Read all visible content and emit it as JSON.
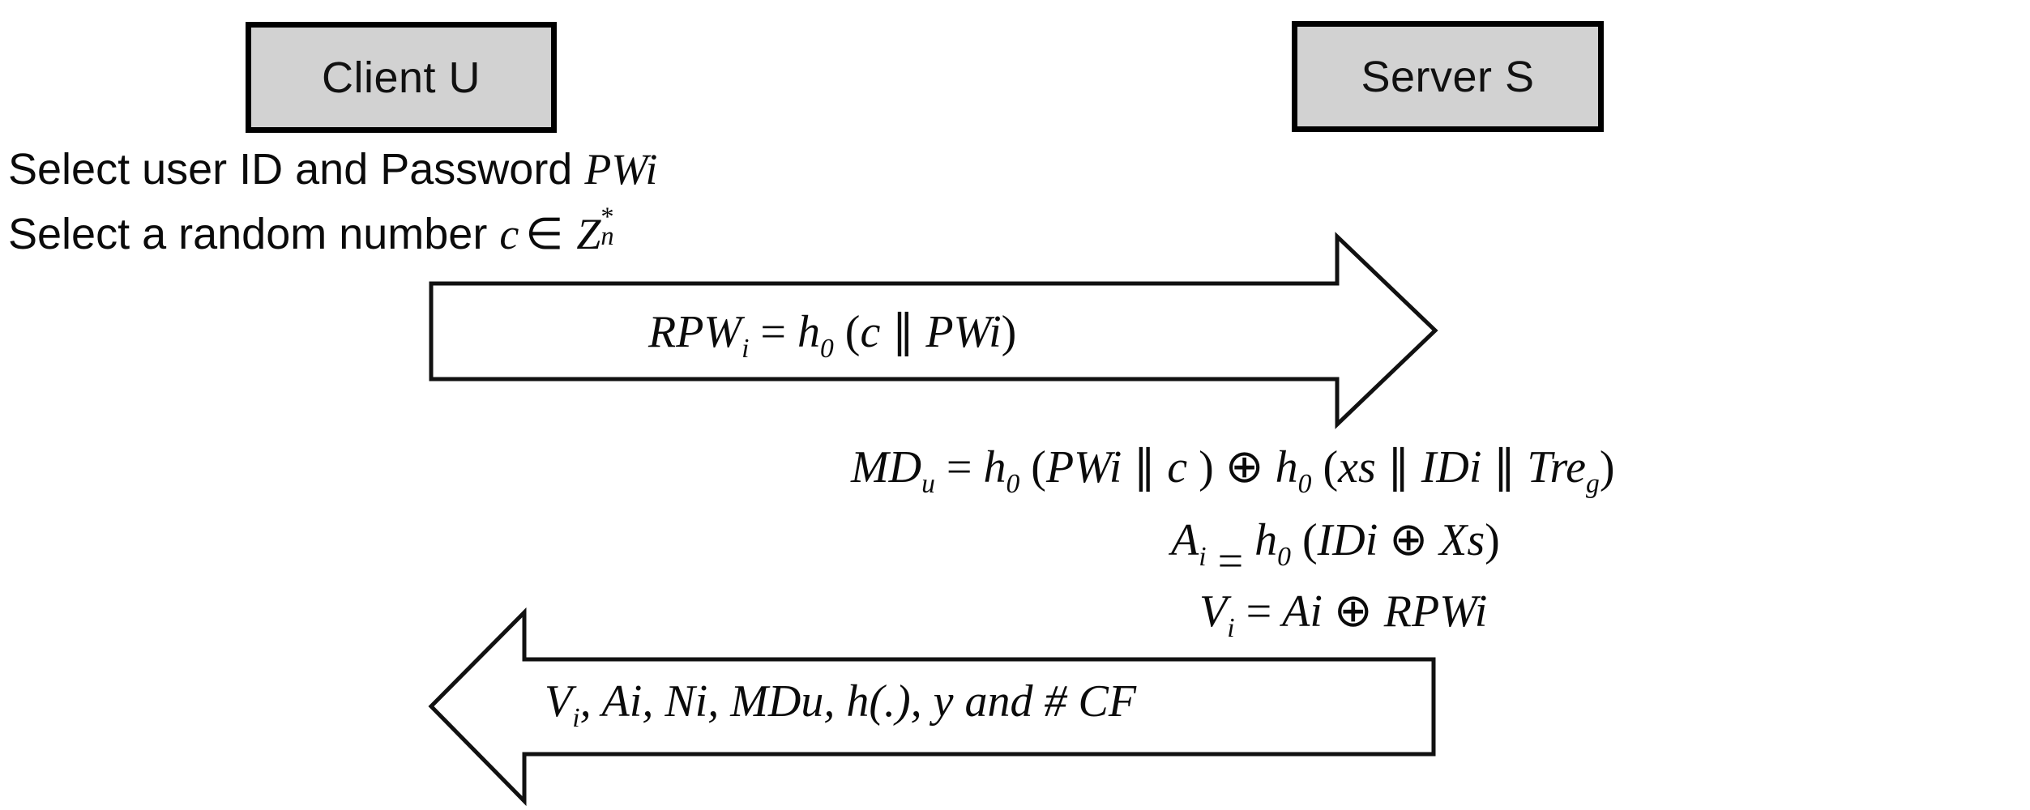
{
  "diagram": {
    "title": "Client-Server registration phase protocol",
    "background_color": "#ffffff",
    "box_fill_color": "#d2d2d2",
    "stroke_color": "#111111"
  },
  "entities": {
    "client": {
      "label": "Client U",
      "name": "client-entity"
    },
    "server": {
      "label": "Server S",
      "name": "server-entity"
    }
  },
  "client_steps": [
    {
      "id": "step-select-id-password",
      "prefix": "Select user ID and Password ",
      "symbol": "PWi"
    },
    {
      "id": "step-select-random",
      "prefix": "Select a random number ",
      "symbol_c": "c",
      "member_op": "∈",
      "set_base": "Z",
      "set_star": "*",
      "set_sub": "n"
    }
  ],
  "messages": [
    {
      "id": "msg-client-to-server",
      "direction": "right",
      "from": "Client U",
      "to": "Server S",
      "label_parts": {
        "lhs": "RPW",
        "lhs_sub": "i",
        "equals": "=",
        "hash": "h",
        "hash_sub": "0",
        "open": " (",
        "arg1": "c",
        "concat": "∥",
        "arg2": "PWi",
        "close": ")"
      },
      "label_plain": "RPWi = h0 (c ∥ PWi)"
    },
    {
      "id": "msg-server-to-client",
      "direction": "left",
      "from": "Server S",
      "to": "Client U",
      "label_parts": {
        "v": "V",
        "v_sub": "i",
        "rest": ", Ai, Ni, MDu, h(.), y and # CF"
      },
      "label_plain": "Vi, Ai, Ni, MDu, h(.), y and # CF"
    }
  ],
  "server_computations": [
    {
      "id": "comp-mdu",
      "plain": "MDu = h0 (PWi ∥ c ) ⊕ h0 (xs ∥ IDi ∥ Treg)",
      "parts": {
        "lhs": "MD",
        "lhs_sub": "u",
        "equals": "=",
        "h1": "h",
        "h1_sub": "0",
        "open1": " (",
        "a1": "PWi",
        "cc1": "∥",
        "a2": "c",
        "close1": " )",
        "xor": "⊕",
        "h2": "h",
        "h2_sub": "0",
        "open2": " (",
        "b1": "xs",
        "cc2": "∥",
        "b2": "IDi",
        "cc3": "∥",
        "b3": "Tre",
        "b3_sub": "g",
        "close2": ")"
      }
    },
    {
      "id": "comp-ai",
      "plain": "Ai = h0 (IDi ⊕ Xs)",
      "parts": {
        "lhs": "A",
        "lhs_sub": "i",
        "equals": "=",
        "h": "h",
        "h_sub": "0",
        "open": " (",
        "a1": "IDi",
        "xor": "⊕",
        "a2": "Xs",
        "close": ")"
      }
    },
    {
      "id": "comp-vi",
      "plain": "Vi = Ai ⊕ RPWi",
      "parts": {
        "lhs": "V",
        "lhs_sub": "i",
        "equals": "=",
        "a1": "Ai",
        "xor": "⊕",
        "a2": "RPWi"
      }
    }
  ]
}
